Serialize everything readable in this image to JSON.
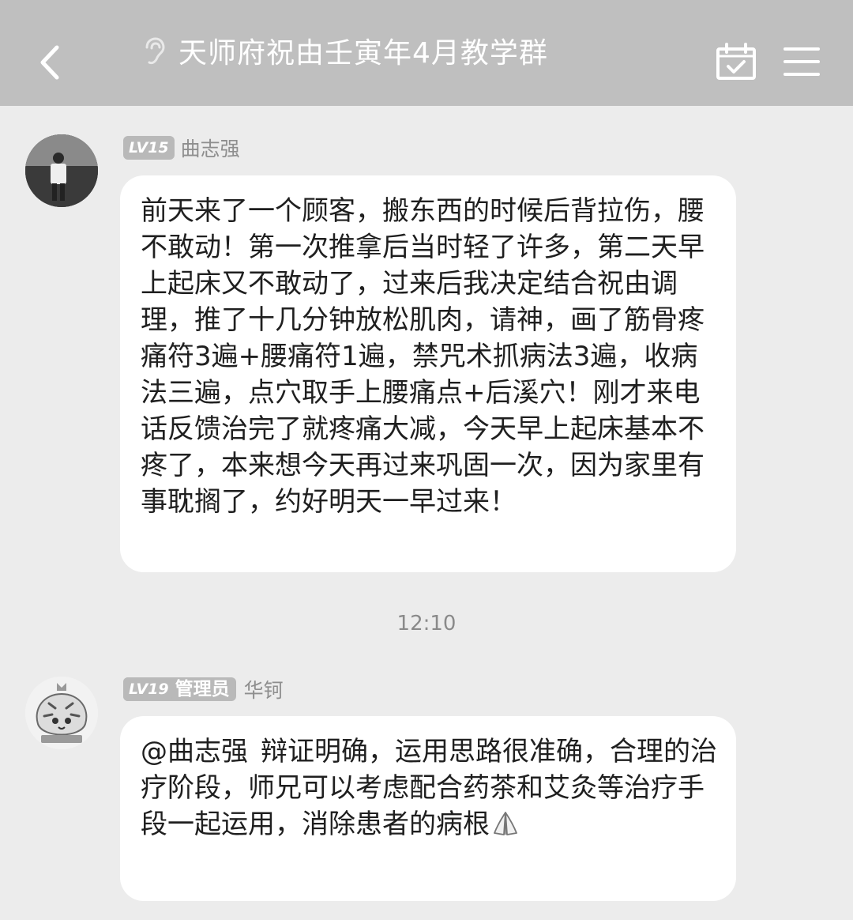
{
  "header": {
    "title": "天师府祝由壬寅年4月教学群",
    "back_icon": "chevron-left-icon",
    "mode_icon": "ear-icon",
    "calendar_icon": "calendar-check-icon",
    "menu_icon": "hamburger-menu-icon",
    "background": "#bfbfbf"
  },
  "messages": [
    {
      "level": "LV15",
      "role": "",
      "sender": "曲志强",
      "text": "前天来了一个顾客，搬东西的时候后背拉伤，腰不敢动！第一次推拿后当时轻了许多，第二天早上起床又不敢动了，过来后我决定结合祝由调理，推了十几分钟放松肌肉，请神，画了筋骨疼痛符3遍+腰痛符1遍，禁咒术抓病法3遍，收病法三遍，点穴取手上腰痛点+后溪穴！刚才来电话反馈治完了就疼痛大减，今天早上起床基本不疼了，本来想今天再过来巩固一次，因为家里有事耽搁了，约好明天一早过来！"
    },
    {
      "level": "LV19",
      "role": "管理员",
      "sender": "华钶",
      "mention": "@曲志强",
      "text": "辩证明确，运用思路很准确，合理的治疗阶段，师兄可以考虑配合药茶和艾灸等治疗手段一起运用，消除患者的病根",
      "emoji": "pray-hands-icon"
    }
  ],
  "timestamp": "12:10"
}
